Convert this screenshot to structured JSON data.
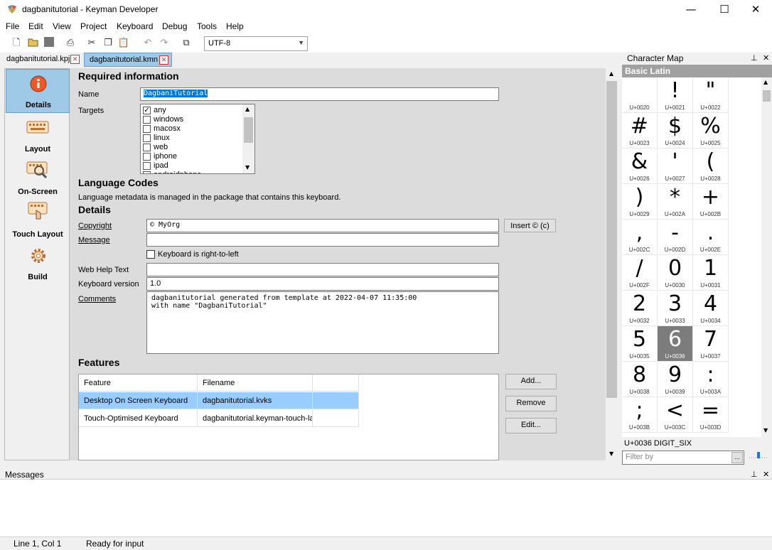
{
  "window": {
    "title": "dagbanitutorial - Keyman Developer",
    "minimize": "—",
    "maximize": "☐",
    "close": "✕"
  },
  "menu": [
    "File",
    "Edit",
    "View",
    "Project",
    "Keyboard",
    "Debug",
    "Tools",
    "Help"
  ],
  "toolbar": {
    "encoding": "UTF-8",
    "icons": [
      "new-file-icon",
      "open-folder-icon",
      "save-icon",
      "print-icon",
      "cut-icon",
      "copy-icon",
      "paste-icon",
      "undo-icon",
      "redo-icon",
      "window-icon"
    ]
  },
  "tabs": [
    {
      "label": "dagbanitutorial.kpj",
      "active": false
    },
    {
      "label": "dagbanitutorial.kmn",
      "active": true
    }
  ],
  "nav": [
    {
      "label": "Details",
      "icon": "info-icon",
      "active": true
    },
    {
      "label": "Layout",
      "icon": "keyboard-icon",
      "active": false
    },
    {
      "label": "On-Screen",
      "icon": "on-screen-keyboard-icon",
      "active": false
    },
    {
      "label": "Touch Layout",
      "icon": "touch-layout-icon",
      "active": false
    },
    {
      "label": "Build",
      "icon": "gear-icon",
      "active": false
    }
  ],
  "details": {
    "required_heading": "Required information",
    "name_label": "Name",
    "name_value": "DagbaniTutorial",
    "targets_label": "Targets",
    "targets": [
      {
        "label": "any",
        "checked": true
      },
      {
        "label": "windows",
        "checked": false
      },
      {
        "label": "macosx",
        "checked": false
      },
      {
        "label": "linux",
        "checked": false
      },
      {
        "label": "web",
        "checked": false
      },
      {
        "label": "iphone",
        "checked": false
      },
      {
        "label": "ipad",
        "checked": false
      },
      {
        "label": "androidphone",
        "checked": false
      }
    ],
    "language_heading": "Language Codes",
    "language_note": "Language metadata is managed in the package that contains this keyboard.",
    "details_heading": "Details",
    "copyright_label": "Copyright",
    "copyright_value": "© MyOrg",
    "insert_copyright_button": "Insert © (c)",
    "message_label": "Message",
    "message_value": "",
    "rtl_label": "Keyboard is right-to-left",
    "rtl_checked": false,
    "webhelp_label": "Web Help Text",
    "webhelp_value": "",
    "version_label": "Keyboard version",
    "version_value": "1.0",
    "comments_label": "Comments",
    "comments_line1": "dagbanitutorial generated from template at 2022-04-07 11:35:00",
    "comments_line2": "with name \"DagbaniTutorial\""
  },
  "features": {
    "heading": "Features",
    "columns": [
      "Feature",
      "Filename"
    ],
    "rows": [
      {
        "feature": "Desktop On Screen Keyboard",
        "filename": "dagbanitutorial.kvks",
        "selected": true
      },
      {
        "feature": "Touch-Optimised Keyboard",
        "filename": "dagbanitutorial.keyman-touch-layout",
        "selected": false
      }
    ],
    "add_button": "Add...",
    "remove_button": "Remove",
    "edit_button": "Edit..."
  },
  "charmap": {
    "title": "Character Map",
    "pin": "⊥",
    "close": "✕",
    "block": "Basic Latin",
    "cells": [
      {
        "glyph": " ",
        "code": "U+0020"
      },
      {
        "glyph": "!",
        "code": "U+0021"
      },
      {
        "glyph": "\"",
        "code": "U+0022"
      },
      {
        "glyph": "#",
        "code": "U+0023"
      },
      {
        "glyph": "$",
        "code": "U+0024"
      },
      {
        "glyph": "%",
        "code": "U+0025"
      },
      {
        "glyph": "&",
        "code": "U+0026"
      },
      {
        "glyph": "'",
        "code": "U+0027"
      },
      {
        "glyph": "(",
        "code": "U+0028"
      },
      {
        "glyph": ")",
        "code": "U+0029"
      },
      {
        "glyph": "*",
        "code": "U+002A"
      },
      {
        "glyph": "+",
        "code": "U+002B"
      },
      {
        "glyph": ",",
        "code": "U+002C"
      },
      {
        "glyph": "-",
        "code": "U+002D"
      },
      {
        "glyph": ".",
        "code": "U+002E"
      },
      {
        "glyph": "/",
        "code": "U+002F"
      },
      {
        "glyph": "0",
        "code": "U+0030"
      },
      {
        "glyph": "1",
        "code": "U+0031"
      },
      {
        "glyph": "2",
        "code": "U+0032"
      },
      {
        "glyph": "3",
        "code": "U+0033"
      },
      {
        "glyph": "4",
        "code": "U+0034"
      },
      {
        "glyph": "5",
        "code": "U+0035"
      },
      {
        "glyph": "6",
        "code": "U+0036"
      },
      {
        "glyph": "7",
        "code": "U+0037"
      },
      {
        "glyph": "8",
        "code": "U+0038"
      },
      {
        "glyph": "9",
        "code": "U+0039"
      },
      {
        "glyph": ":",
        "code": "U+003A"
      },
      {
        "glyph": ";",
        "code": "U+003B"
      },
      {
        "glyph": "<",
        "code": "U+003C"
      },
      {
        "glyph": "=",
        "code": "U+003D"
      }
    ],
    "selected_index": 22,
    "status": "U+0036 DIGIT_SIX",
    "filter_placeholder": "Filter by",
    "filter_button": "..."
  },
  "messages": {
    "title": "Messages"
  },
  "status": {
    "position": "Line 1, Col 1",
    "state": "Ready for input"
  }
}
